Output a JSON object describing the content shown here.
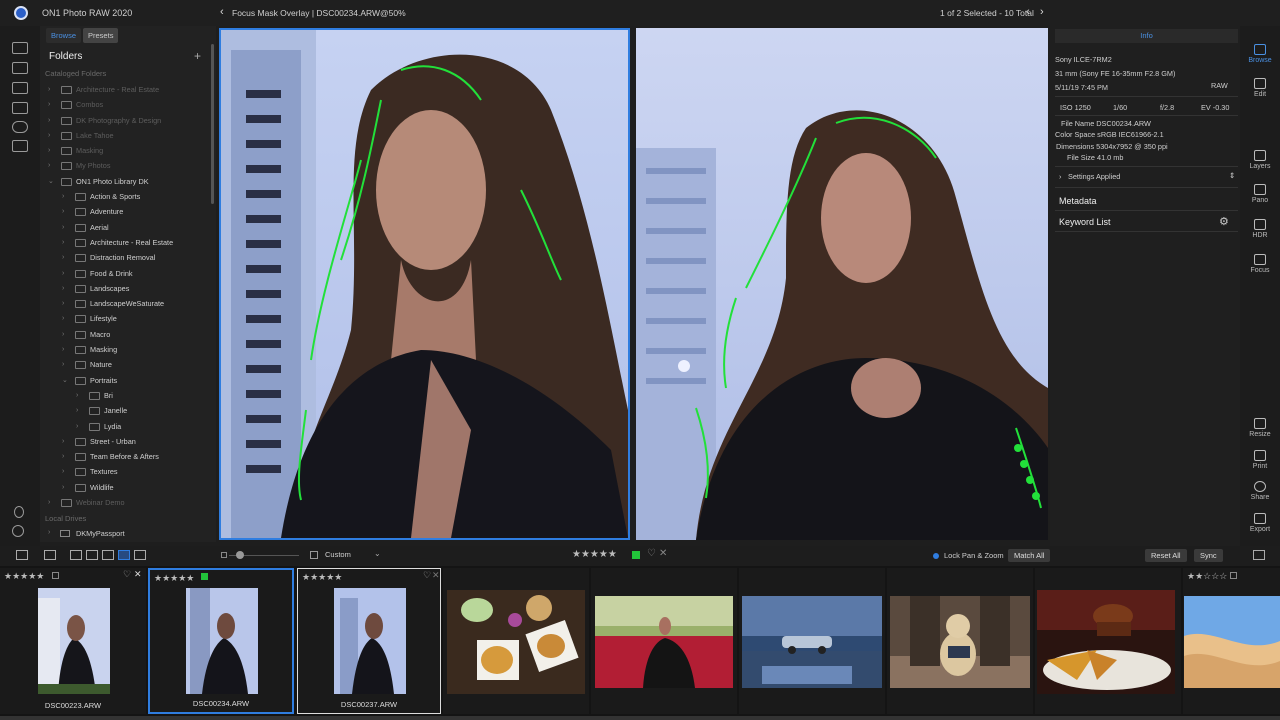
{
  "app": {
    "title": "ON1 Photo RAW 2020",
    "breadcrumb": "Focus Mask Overlay | DSC00234.ARW@50%",
    "selection": "1 of 2 Selected - 10 Total"
  },
  "browser": {
    "tabs": [
      "Browse",
      "Presets"
    ],
    "folders_heading": "Folders",
    "cataloged_heading": "Cataloged Folders",
    "local_heading": "Local Drives",
    "tree": [
      {
        "label": "Architecture - Real Estate",
        "level": 1,
        "dim": true
      },
      {
        "label": "Combos",
        "level": 1,
        "dim": true
      },
      {
        "label": "DK Photography & Design",
        "level": 1,
        "dim": true
      },
      {
        "label": "Lake Tahoe",
        "level": 1,
        "dim": true
      },
      {
        "label": "Masking",
        "level": 1,
        "dim": true
      },
      {
        "label": "My Photos",
        "level": 1,
        "dim": true
      },
      {
        "label": "ON1 Photo Library DK",
        "level": 1,
        "dim": false,
        "open": true
      },
      {
        "label": "Action & Sports",
        "level": 2
      },
      {
        "label": "Adventure",
        "level": 2
      },
      {
        "label": "Aerial",
        "level": 2
      },
      {
        "label": "Architecture - Real Estate",
        "level": 2
      },
      {
        "label": "Distraction Removal",
        "level": 2
      },
      {
        "label": "Food & Drink",
        "level": 2
      },
      {
        "label": "Landscapes",
        "level": 2
      },
      {
        "label": "LandscapeWeSaturate",
        "level": 2
      },
      {
        "label": "Lifestyle",
        "level": 2
      },
      {
        "label": "Macro",
        "level": 2
      },
      {
        "label": "Masking",
        "level": 2
      },
      {
        "label": "Nature",
        "level": 2
      },
      {
        "label": "Portraits",
        "level": 2,
        "open": true
      },
      {
        "label": "Bri",
        "level": 3
      },
      {
        "label": "Janelle",
        "level": 3
      },
      {
        "label": "Lydia",
        "level": 3
      },
      {
        "label": "Street - Urban",
        "level": 2
      },
      {
        "label": "Team Before & Afters",
        "level": 2
      },
      {
        "label": "Textures",
        "level": 2
      },
      {
        "label": "Wildlife",
        "level": 2
      },
      {
        "label": "Webinar Demo",
        "level": 1,
        "dim": true
      }
    ],
    "drive": "DKMyPassport"
  },
  "info": {
    "tab": "Info",
    "camera": "Sony ILCE-7RM2",
    "lens": "31 mm (Sony FE 16-35mm F2.8 GM)",
    "date": "5/11/19 7:45 PM",
    "format": "RAW",
    "iso": "ISO 1250",
    "shutter": "1/60",
    "aperture": "f/2.8",
    "ev": "EV -0.30",
    "filename": "File Name DSC00234.ARW",
    "colorspace": "Color Space sRGB IEC61966-2.1",
    "dimensions": "Dimensions 5304x7952 @ 350 ppi",
    "filesize": "File Size 41.0 mb",
    "settings": "Settings Applied",
    "metadata": "Metadata",
    "keywords": "Keyword List"
  },
  "right_tools": [
    "Browse",
    "Edit",
    "Layers",
    "Pano",
    "HDR",
    "Focus",
    "Resize",
    "Print",
    "Share",
    "Export"
  ],
  "toolbar": {
    "view": "Custom",
    "lock": "Lock Pan & Zoom",
    "match": "Match All",
    "reset": "Reset All",
    "sync": "Sync",
    "rating": "★★★★★"
  },
  "filmstrip": [
    {
      "name": "DSC00223.ARW",
      "stars": "★★★★★"
    },
    {
      "name": "DSC00234.ARW",
      "stars": "★★★★★"
    },
    {
      "name": "DSC00237.ARW",
      "stars": "★★★★★"
    },
    {
      "name": "",
      "stars": ""
    },
    {
      "name": "",
      "stars": ""
    },
    {
      "name": "",
      "stars": ""
    },
    {
      "name": "",
      "stars": ""
    },
    {
      "name": "",
      "stars": ""
    },
    {
      "name": "",
      "stars": "★★☆☆☆"
    }
  ],
  "colors": {
    "accent": "#2f7de0",
    "mask": "#22e03a",
    "green_label": "#22c43a"
  }
}
